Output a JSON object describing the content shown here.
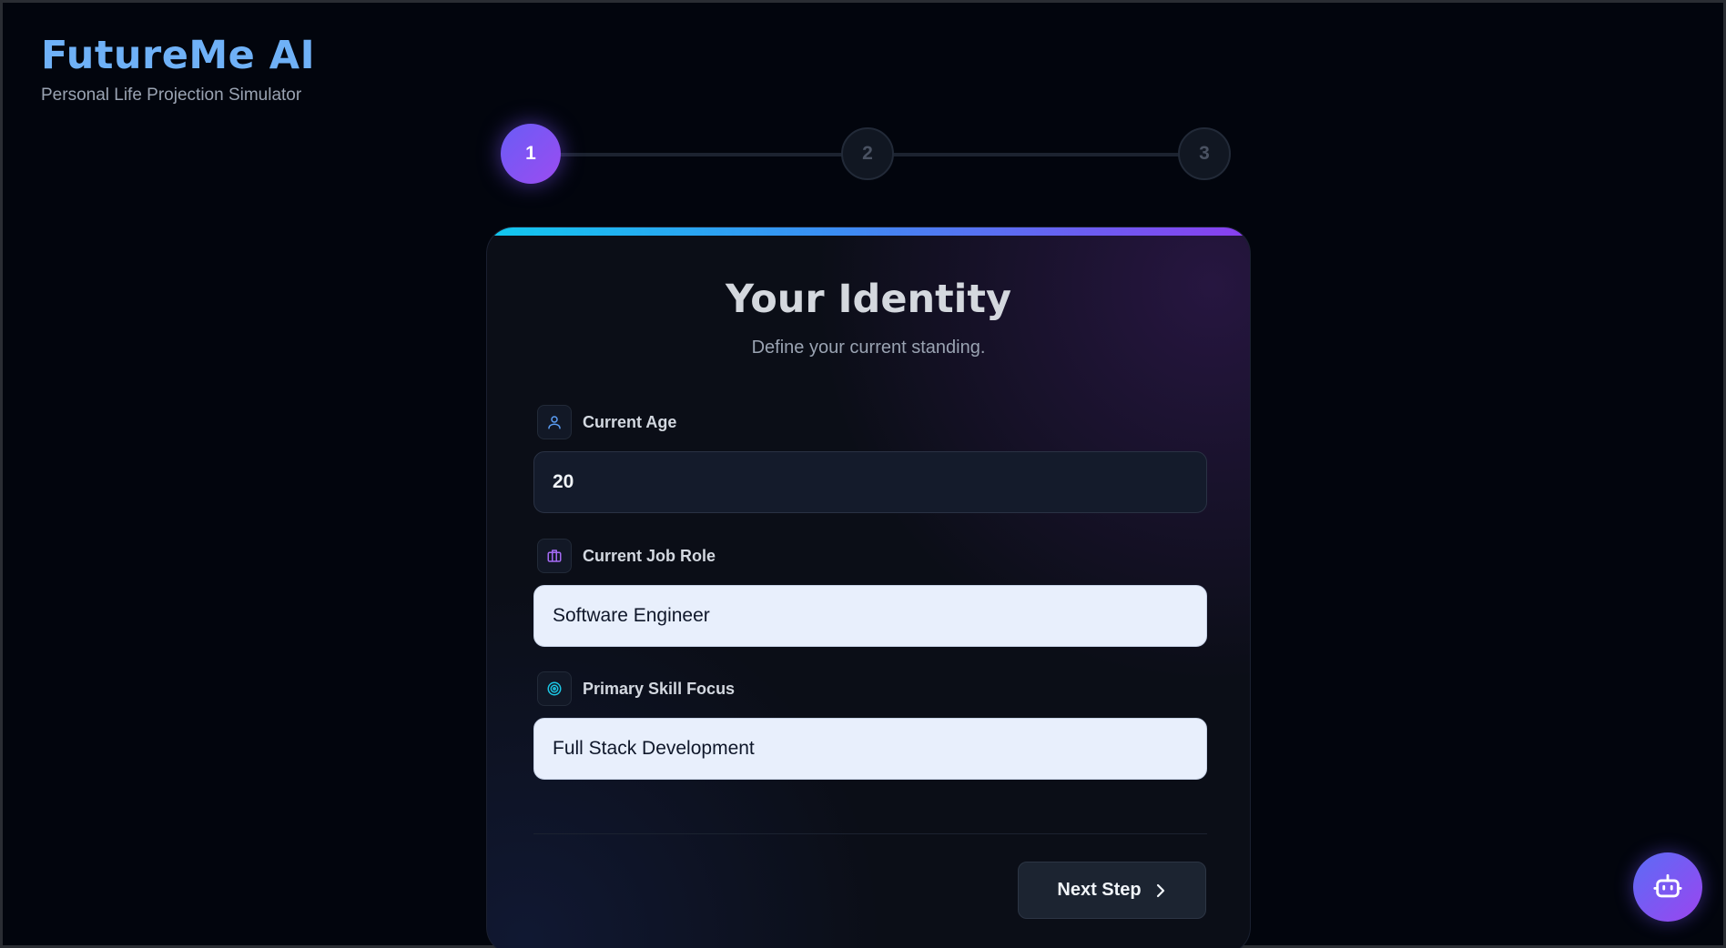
{
  "brand": {
    "title": "FutureMe AI",
    "subtitle": "Personal Life Projection Simulator"
  },
  "stepper": {
    "steps": [
      "1",
      "2",
      "3"
    ],
    "active_step": 1
  },
  "card": {
    "title": "Your Identity",
    "subtitle": "Define your current standing.",
    "fields": [
      {
        "label": "Current Age",
        "value": "20",
        "icon": "user-icon"
      },
      {
        "label": "Current Job Role",
        "value": "Software Engineer",
        "icon": "briefcase-icon"
      },
      {
        "label": "Primary Skill Focus",
        "value": "Full Stack Development",
        "icon": "target-icon"
      }
    ],
    "next_label": "Next Step"
  },
  "assistant": {
    "icon": "robot-icon"
  },
  "colors": {
    "accent_blue": "#6fb1f7",
    "accent_purple": "#8a3ef0",
    "accent_cyan": "#11c8ee",
    "background": "#02050d"
  }
}
